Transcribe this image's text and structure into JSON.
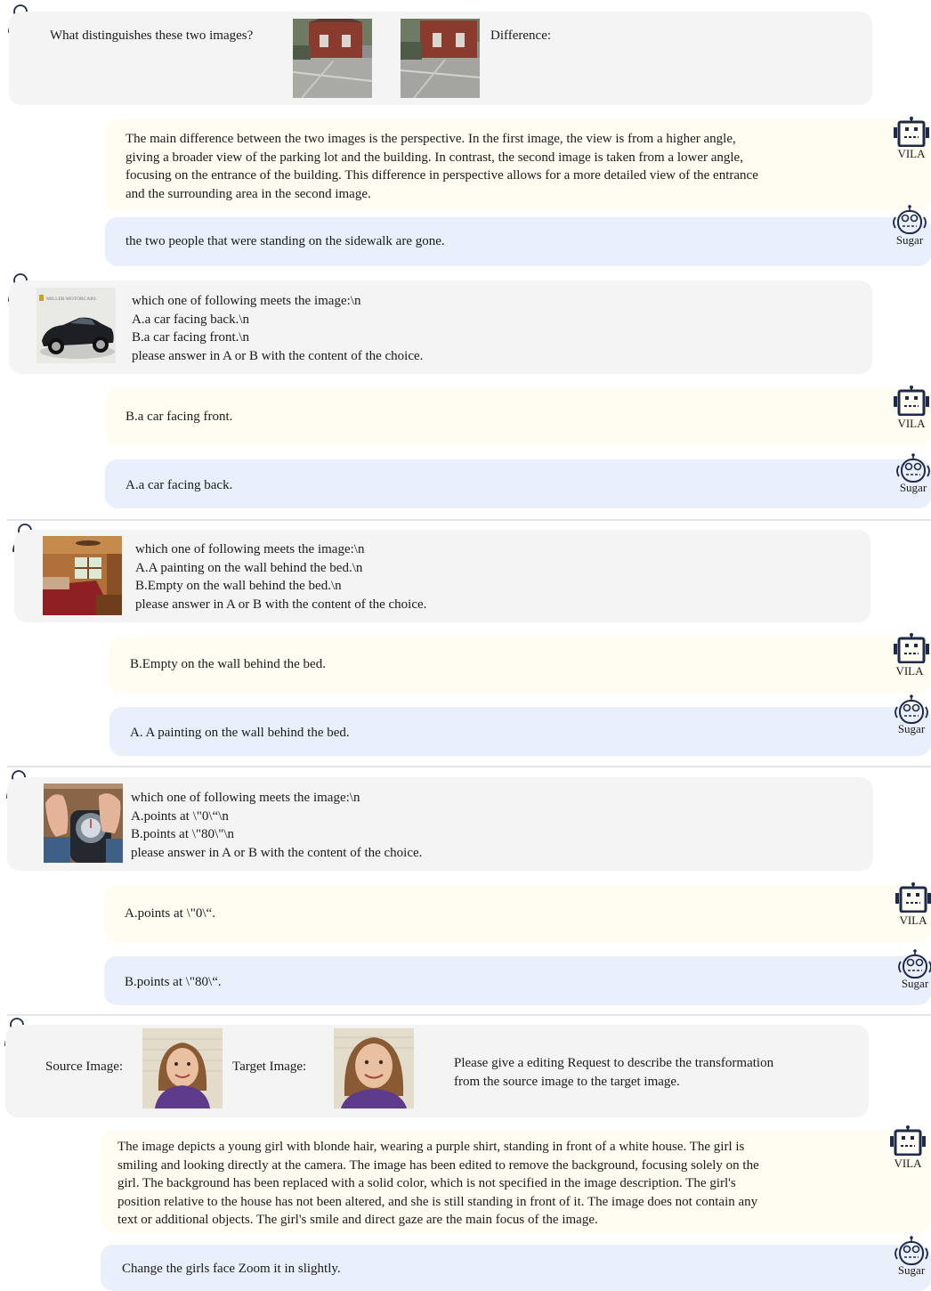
{
  "labels": {
    "vila": "VILA",
    "sugar": "Sugar"
  },
  "colors": {
    "user_bubble": "#f4f4f5",
    "vila_bubble": "#fffcf2",
    "sugar_bubble": "#e9f0fb",
    "icon": "#1e2a4a"
  },
  "icons": {
    "user": "person-outline-icon",
    "vila": "robot-square-icon",
    "sugar": "robot-round-icon"
  },
  "conv1": {
    "user_question": "What distinguishes these two images?",
    "user_suffix": "Difference:",
    "vila_answer": "The main difference between the two images is the perspective. In the first image, the view is from a higher angle,\ngiving a broader view of the parking lot and the building. In contrast, the second image is taken from a lower angle,\nfocusing on the entrance of the building. This difference in perspective allows for a more detailed view of the entrance\nand the surrounding area in the second image.",
    "sugar_answer": "the two people that were standing on the sidewalk are gone."
  },
  "conv2": {
    "thumb_text": "MILLER MOTORCARS",
    "user_prompt": "which one of following meets the image:\\n\nA.a car facing back.\\n\nB.a car facing front.\\n\nplease answer in A or B with the content of the choice.",
    "vila_answer": "B.a car facing front.",
    "sugar_answer": "A.a car facing back."
  },
  "conv3": {
    "user_prompt": "which one of following meets the image:\\n\nA.A painting on the wall behind the bed.\\n\nB.Empty on the wall behind the bed.\\n\nplease answer in A or B with the content of the choice.",
    "vila_answer": "B.Empty on the wall behind the bed.",
    "sugar_answer": "A. A painting on the wall behind the bed."
  },
  "conv4": {
    "user_prompt": "which one of following meets the image:\\n\nA.points at \\\"0\\“\\n\nB.points at \\\"80\\\"\\n\nplease answer in A or B with the content of the choice.",
    "vila_answer": "A.points at \\\"0\\“.",
    "sugar_answer": "B.points at \\\"80\\“."
  },
  "conv5": {
    "source_label": "Source Image:",
    "target_label": "Target Image:",
    "user_prompt": "Please give a editing Request to describe the transformation\nfrom the source image to the target image.",
    "vila_answer": "The image depicts a young girl with blonde hair, wearing a purple shirt, standing in front of a white house. The girl is\nsmiling and looking directly at the camera. The image has been edited to remove the background, focusing solely on the\ngirl. The background has been replaced with a solid color, which is not specified in the image description. The girl's\nposition relative to the house has not been altered, and she is still standing in front of it. The image does not contain any\ntext or additional objects. The girl's smile and direct gaze are the main focus of the image.",
    "sugar_answer": "Change the girls face Zoom it in slightly."
  }
}
